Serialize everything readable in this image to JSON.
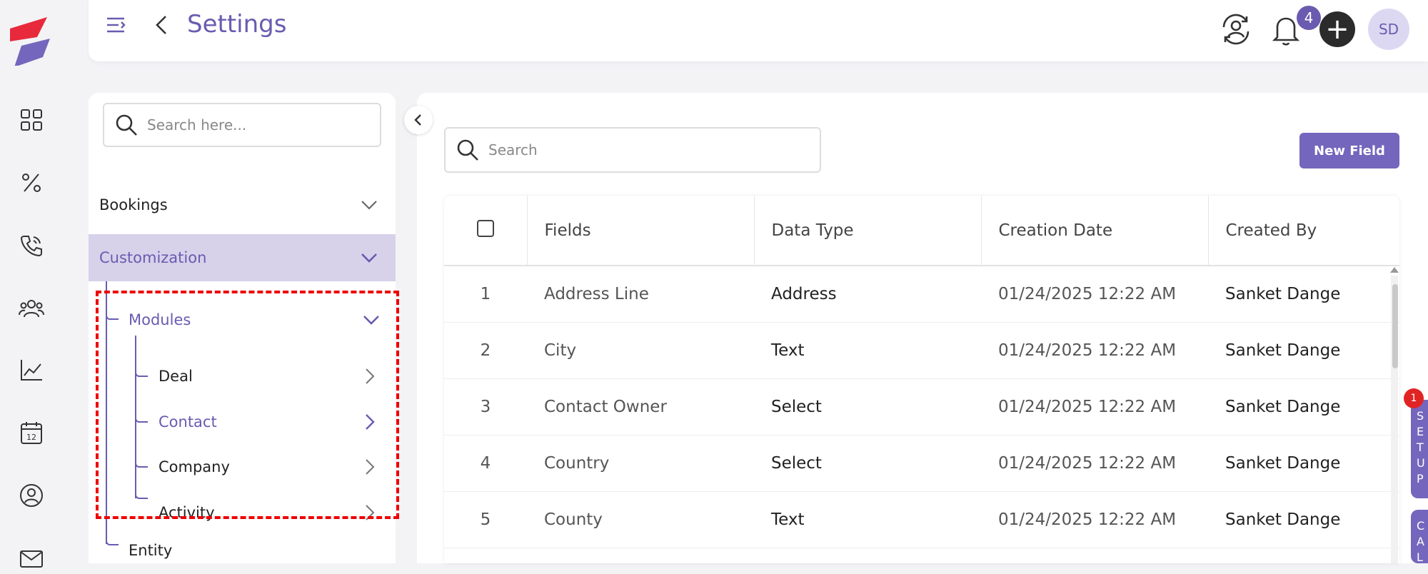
{
  "header": {
    "title": "Settings",
    "notification_count": "4",
    "avatar_initials": "SD",
    "add_symbol": "+"
  },
  "rail": {
    "icons": [
      "grid-icon",
      "percent-icon",
      "phone-icon",
      "users-icon",
      "chart-icon",
      "calendar-icon",
      "contact-icon",
      "mail-icon"
    ],
    "calendar_day": "12"
  },
  "sidebar": {
    "search_placeholder": "Search here...",
    "sections": [
      {
        "label": "Bookings",
        "expanded": false
      },
      {
        "label": "Customization",
        "expanded": true,
        "active": true
      }
    ],
    "modules": {
      "label": "Modules",
      "items": [
        {
          "label": "Deal",
          "active": false
        },
        {
          "label": "Contact",
          "active": true
        },
        {
          "label": "Company",
          "active": false
        },
        {
          "label": "Activity",
          "active": false
        }
      ]
    },
    "entity_label": "Entity"
  },
  "main": {
    "search_placeholder": "Search",
    "new_field_label": "New Field",
    "table": {
      "columns": [
        "Fields",
        "Data Type",
        "Creation Date",
        "Created By"
      ],
      "rows": [
        {
          "num": "1",
          "field": "Address Line",
          "type": "Address",
          "date": "01/24/2025 12:22 AM",
          "creator": "Sanket Dange"
        },
        {
          "num": "2",
          "field": "City",
          "type": "Text",
          "date": "01/24/2025 12:22 AM",
          "creator": "Sanket Dange"
        },
        {
          "num": "3",
          "field": "Contact Owner",
          "type": "Select",
          "date": "01/24/2025 12:22 AM",
          "creator": "Sanket Dange"
        },
        {
          "num": "4",
          "field": "Country",
          "type": "Select",
          "date": "01/24/2025 12:22 AM",
          "creator": "Sanket Dange"
        },
        {
          "num": "5",
          "field": "County",
          "type": "Text",
          "date": "01/24/2025 12:22 AM",
          "creator": "Sanket Dange"
        }
      ]
    }
  },
  "edge_widget": {
    "badge": "1",
    "card1_letters": [
      "S",
      "E",
      "T",
      "U",
      "P"
    ],
    "card2_letters": [
      "C",
      "A",
      "L"
    ]
  },
  "colors": {
    "accent": "#6a5bb0",
    "button": "#7466bd",
    "active_bg": "#d7d2ea",
    "highlight": "#ee0000"
  }
}
